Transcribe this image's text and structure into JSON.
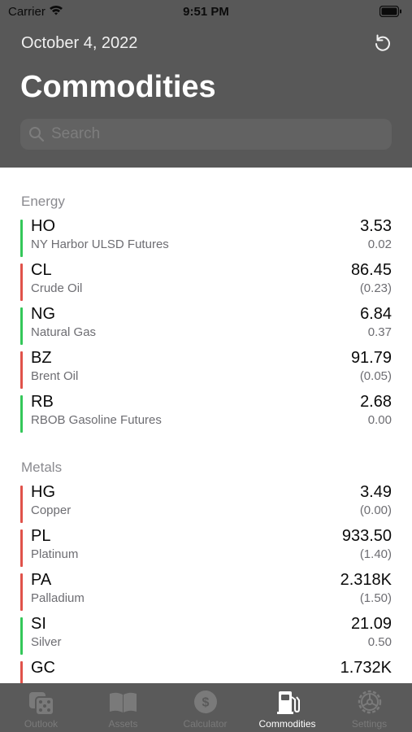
{
  "status_bar": {
    "carrier": "Carrier",
    "time": "9:51 PM"
  },
  "header": {
    "date": "October 4, 2022",
    "title": "Commodities",
    "search_placeholder": "Search"
  },
  "sections": [
    {
      "title": "Energy",
      "items": [
        {
          "symbol": "HO",
          "name": "NY Harbor ULSD Futures",
          "value": "3.53",
          "change": "0.02",
          "trend": "up"
        },
        {
          "symbol": "CL",
          "name": "Crude Oil",
          "value": "86.45",
          "change": "(0.23)",
          "trend": "down"
        },
        {
          "symbol": "NG",
          "name": "Natural Gas",
          "value": "6.84",
          "change": "0.37",
          "trend": "up"
        },
        {
          "symbol": "BZ",
          "name": "Brent Oil",
          "value": "91.79",
          "change": "(0.05)",
          "trend": "down"
        },
        {
          "symbol": "RB",
          "name": "RBOB Gasoline Futures",
          "value": "2.68",
          "change": "0.00",
          "trend": "up"
        }
      ]
    },
    {
      "title": "Metals",
      "items": [
        {
          "symbol": "HG",
          "name": "Copper",
          "value": "3.49",
          "change": "(0.00)",
          "trend": "down"
        },
        {
          "symbol": "PL",
          "name": "Platinum",
          "value": "933.50",
          "change": "(1.40)",
          "trend": "down"
        },
        {
          "symbol": "PA",
          "name": "Palladium",
          "value": "2.318K",
          "change": "(1.50)",
          "trend": "down"
        },
        {
          "symbol": "SI",
          "name": "Silver",
          "value": "21.09",
          "change": "0.50",
          "trend": "up"
        },
        {
          "symbol": "GC",
          "name": "",
          "value": "1.732K",
          "change": "",
          "trend": "down"
        }
      ]
    }
  ],
  "tab_bar": {
    "tabs": [
      {
        "label": "Outlook",
        "icon": "dice-icon",
        "active": false
      },
      {
        "label": "Assets",
        "icon": "book-icon",
        "active": false
      },
      {
        "label": "Calculator",
        "icon": "dollar-circle-icon",
        "active": false
      },
      {
        "label": "Commodities",
        "icon": "fuel-pump-icon",
        "active": true
      },
      {
        "label": "Settings",
        "icon": "gear-icon",
        "active": false
      }
    ]
  },
  "colors": {
    "up": "#34c759",
    "down": "#e0524a",
    "overlay_header": "#585858",
    "tab_bar": "#5a5a5a"
  }
}
